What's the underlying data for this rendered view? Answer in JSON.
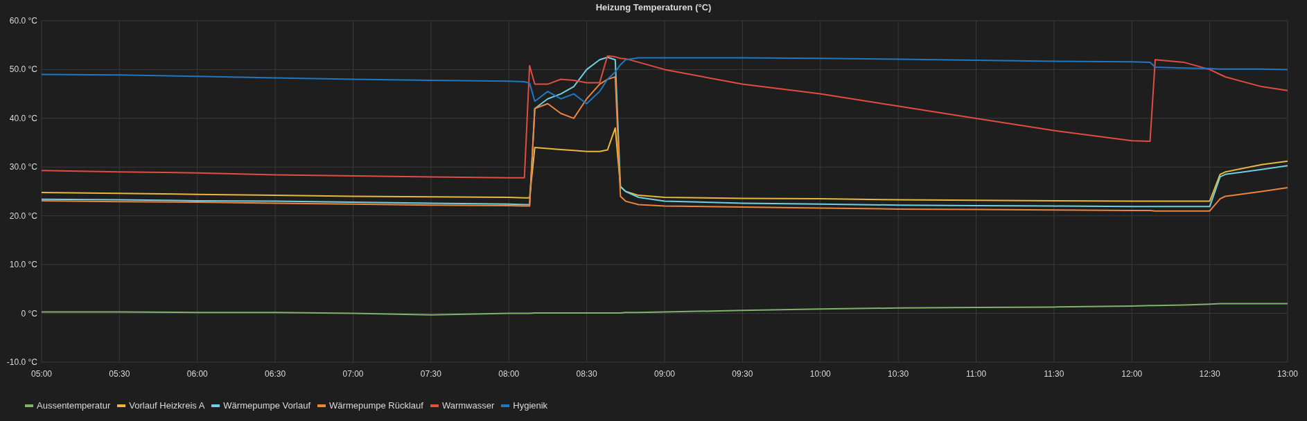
{
  "panel": {
    "title": "Heizung Temperaturen (°C)",
    "chart_data": {
      "type": "line",
      "grid": true,
      "x": [
        5,
        5.5,
        6,
        6.5,
        7,
        7.5,
        8,
        8.1,
        8.1333,
        8.1667,
        8.25,
        8.3333,
        8.4167,
        8.5,
        8.5833,
        8.6333,
        8.6833,
        8.7167,
        8.75,
        8.8333,
        9,
        9.5,
        10,
        10.5,
        11,
        11.5,
        12,
        12.1167,
        12.15,
        12.3333,
        12.5,
        12.5667,
        12.6,
        12.8333,
        13
      ],
      "xlim": [
        5,
        13
      ],
      "ylim": [
        -10,
        60
      ],
      "xticks": [
        {
          "value": 5,
          "label": "05:00"
        },
        {
          "value": 5.5,
          "label": "05:30"
        },
        {
          "value": 6,
          "label": "06:00"
        },
        {
          "value": 6.5,
          "label": "06:30"
        },
        {
          "value": 7,
          "label": "07:00"
        },
        {
          "value": 7.5,
          "label": "07:30"
        },
        {
          "value": 8,
          "label": "08:00"
        },
        {
          "value": 8.5,
          "label": "08:30"
        },
        {
          "value": 9,
          "label": "09:00"
        },
        {
          "value": 9.5,
          "label": "09:30"
        },
        {
          "value": 10,
          "label": "10:00"
        },
        {
          "value": 10.5,
          "label": "10:30"
        },
        {
          "value": 11,
          "label": "11:00"
        },
        {
          "value": 11.5,
          "label": "11:30"
        },
        {
          "value": 12,
          "label": "12:00"
        },
        {
          "value": 12.5,
          "label": "12:30"
        },
        {
          "value": 13,
          "label": "13:00"
        }
      ],
      "yticks": [
        {
          "value": 60,
          "label": "60.0 °C"
        },
        {
          "value": 50,
          "label": "50.0 °C"
        },
        {
          "value": 40,
          "label": "40.0 °C"
        },
        {
          "value": 30,
          "label": "30.0 °C"
        },
        {
          "value": 20,
          "label": "20.0 °C"
        },
        {
          "value": 10,
          "label": "10.0 °C"
        },
        {
          "value": 0,
          "label": "0 °C"
        },
        {
          "value": -10,
          "label": "-10.0 °C"
        }
      ],
      "series": [
        {
          "name": "Aussentemperatur",
          "color": "#7eb26d",
          "values": [
            0.3,
            0.3,
            0.2,
            0.2,
            0,
            -0.3,
            0,
            0,
            0,
            0.1,
            0.1,
            0.1,
            0.1,
            0.1,
            0.1,
            0.1,
            0.1,
            0.1,
            0.2,
            0.2,
            0.3,
            0.6,
            0.9,
            1.1,
            1.2,
            1.3,
            1.5,
            1.6,
            1.6,
            1.7,
            1.9,
            2,
            2,
            2,
            2
          ]
        },
        {
          "name": "Vorlauf Heizkreis A",
          "color": "#eab839",
          "values": [
            24.8,
            24.6,
            24.4,
            24.2,
            24,
            23.9,
            23.8,
            23.7,
            23.7,
            34,
            33.8,
            33.6,
            33.4,
            33.2,
            33.2,
            33.5,
            38,
            26,
            25,
            24.2,
            23.8,
            23.6,
            23.5,
            23.3,
            23.2,
            23.1,
            23,
            23,
            23,
            23,
            23,
            28.5,
            29,
            30.5,
            31.2
          ]
        },
        {
          "name": "Wärmepumpe Vorlauf",
          "color": "#6ed0e0",
          "values": [
            23.4,
            23.3,
            23.1,
            23,
            22.8,
            22.6,
            22.4,
            22.3,
            22.3,
            42,
            44,
            45,
            46.5,
            50,
            52,
            52.5,
            52,
            26,
            25,
            23.8,
            23,
            22.6,
            22.4,
            22.2,
            22.1,
            22,
            21.9,
            21.9,
            21.9,
            21.9,
            21.9,
            28,
            28.5,
            29.5,
            30.3
          ]
        },
        {
          "name": "Wärmepumpe Rücklauf",
          "color": "#ef843c",
          "values": [
            23.1,
            22.9,
            22.8,
            22.6,
            22.4,
            22.2,
            22.1,
            22,
            22,
            42,
            43,
            41,
            40,
            44,
            47,
            48,
            48.5,
            24,
            23,
            22.3,
            22,
            21.8,
            21.6,
            21.4,
            21.3,
            21.2,
            21.1,
            21.1,
            21,
            21,
            21,
            23.5,
            24,
            25,
            25.8
          ]
        },
        {
          "name": "Warmwasser",
          "color": "#e24d42",
          "values": [
            29.3,
            29,
            28.8,
            28.4,
            28.2,
            28,
            27.8,
            27.8,
            50.8,
            47,
            47,
            48,
            47.8,
            47.3,
            47.3,
            52.8,
            52.6,
            52.3,
            52.2,
            51.5,
            50,
            47,
            45,
            42.5,
            40,
            37.5,
            35.4,
            35.3,
            52,
            51.5,
            50,
            49,
            48.5,
            46.5,
            45.7
          ]
        },
        {
          "name": "Hygienik",
          "color": "#1f78c1",
          "values": [
            49,
            48.9,
            48.6,
            48.3,
            48,
            47.8,
            47.6,
            47.5,
            47.2,
            43.5,
            45.5,
            44,
            45,
            43,
            45.5,
            48,
            49.5,
            51,
            52,
            52.4,
            52.4,
            52.4,
            52.3,
            52.1,
            51.9,
            51.7,
            51.6,
            51.5,
            50.5,
            50.3,
            50.2,
            50.1,
            50.1,
            50.1,
            50
          ]
        }
      ]
    }
  }
}
